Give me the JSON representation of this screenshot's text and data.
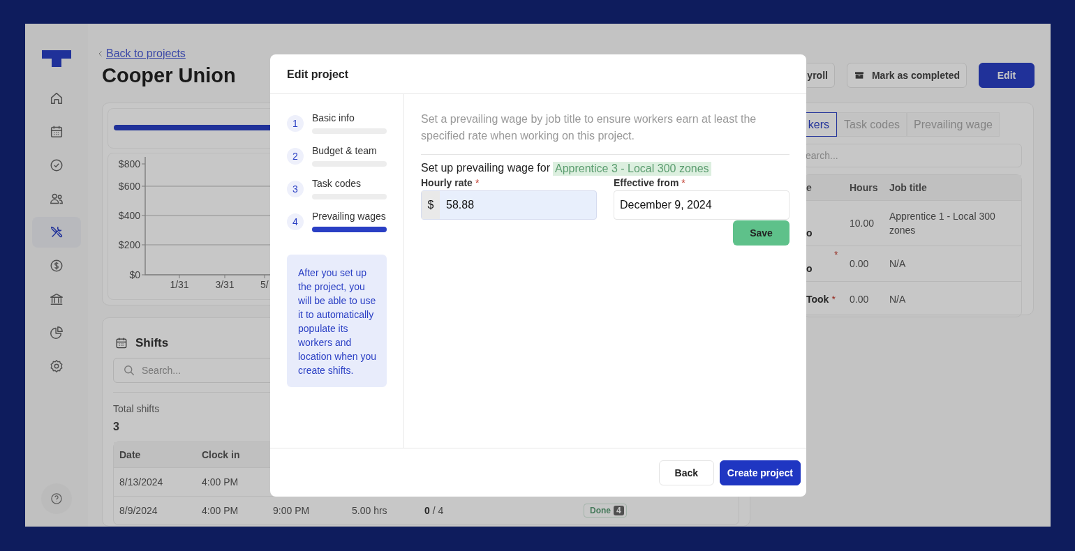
{
  "sidebar": {
    "items": [
      {
        "kind": "home",
        "selected": false
      },
      {
        "kind": "calendar",
        "selected": false
      },
      {
        "kind": "check",
        "selected": false
      },
      {
        "kind": "users",
        "selected": false
      },
      {
        "kind": "tools",
        "selected": true
      },
      {
        "kind": "dollar",
        "selected": false
      },
      {
        "kind": "bank",
        "selected": false
      },
      {
        "kind": "pie",
        "selected": false
      },
      {
        "kind": "gear",
        "selected": false
      }
    ]
  },
  "back_link": "Back to projects",
  "title": "Cooper Union",
  "header_buttons": [
    {
      "label": "yroll",
      "kind": "outline"
    },
    {
      "label": "Mark as completed",
      "kind": "archive"
    },
    {
      "label": "Edit",
      "kind": "primary"
    }
  ],
  "progress": {
    "level": 1
  },
  "chart": {
    "y_ticks": [
      "$800",
      "$600",
      "$400",
      "$200",
      "$0"
    ],
    "x_ticks": [
      "1/31",
      "3/31",
      "5/"
    ]
  },
  "shifts": {
    "title": "Shifts",
    "search_placeholder": "Search...",
    "total_label": "Total shifts",
    "total_value": "3",
    "columns": [
      "Date",
      "Clock in"
    ],
    "rows": [
      {
        "cells": [
          "8/13/2024",
          "4:00 PM"
        ]
      },
      {
        "cells": [
          "8/9/2024",
          "4:00 PM",
          "9:00 PM",
          "5.00 hrs",
          "**0** / 4"
        ],
        "status": {
          "label": "Done",
          "count": "4"
        }
      }
    ]
  },
  "workers": {
    "tabs": [
      {
        "label": "kers",
        "selected": true
      },
      {
        "label": "Task codes",
        "selected": false
      },
      {
        "label": "Prevailing wage",
        "selected": false
      }
    ],
    "search_placeholder": "earch...",
    "columns": [
      "e",
      "Hours",
      "Job title"
    ],
    "rows": [
      {
        "name": "o",
        "hours": "10.00",
        "job_title": "Apprentice 1 - Local 300 zones"
      },
      {
        "name": "o",
        "mark": "*",
        "hours": "0.00",
        "job_title": "N/A"
      },
      {
        "name": "Took",
        "mark": "*",
        "hours": "0.00",
        "job_title": "N/A"
      }
    ]
  },
  "modal": {
    "title": "Edit project",
    "steps": [
      {
        "number": "1",
        "label": "Basic info",
        "selected": false
      },
      {
        "number": "2",
        "label": "Budget & team",
        "selected": false
      },
      {
        "number": "3",
        "label": "Task codes",
        "selected": false
      },
      {
        "number": "4",
        "label": "Prevailing wages",
        "selected": true
      }
    ],
    "note": "After you set up the project, you will be able to use it to automatically populate its workers and location when you create shifts.",
    "description": "Set a prevailing wage by job title to ensure workers earn at least the specified rate when working on this project.",
    "setup_label": "Set up prevailing wage for",
    "job_title": "Apprentice 3 - Local 300 zones",
    "fields": [
      {
        "label": "Hourly rate",
        "required_mark": "*",
        "prefix": "$",
        "value": "58.88",
        "focused": true
      },
      {
        "label": "Effective from",
        "required_mark": "*",
        "value": "December 9, 2024",
        "focused": false
      }
    ],
    "save": "Save",
    "buttons": [
      {
        "label": "Back",
        "kind": "secondary"
      },
      {
        "label": "Create project",
        "kind": "primary"
      }
    ]
  }
}
